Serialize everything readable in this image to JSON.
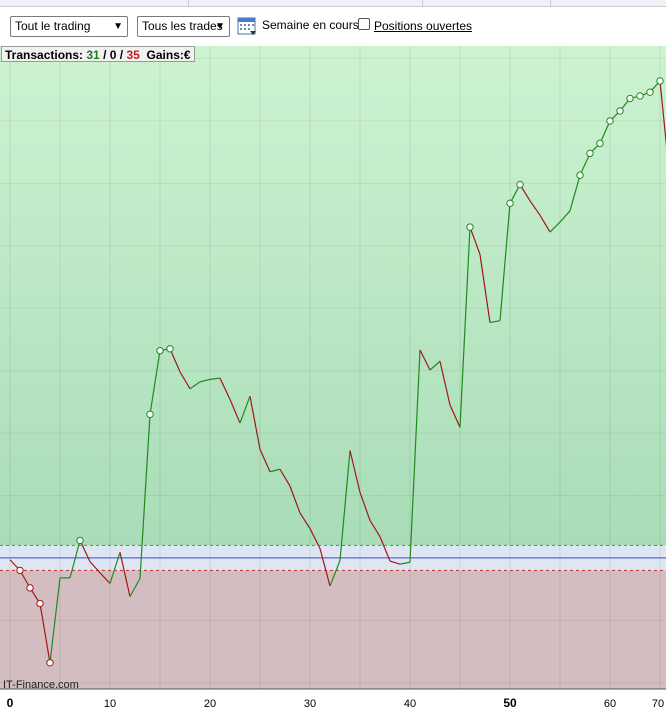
{
  "toolbar": {
    "scope_select": "Tout le trading",
    "trades_select": "Tous les trades",
    "period_label": "Semaine en cours",
    "open_positions_label": "Positions ouvertes",
    "open_positions_checked": false
  },
  "summary": {
    "label": "Transactions:",
    "winners": "31",
    "neutral": "0",
    "losers": "35",
    "separator": "/",
    "gains_label": "Gains:",
    "gains_unit": "€"
  },
  "watermark": "IT-Finance.com",
  "colors": {
    "profit_zone_top": "#cdf3d1",
    "profit_zone_bottom": "#a9dcb8",
    "loss_zone": "#d3bdc0",
    "breakeven_band": "#dfe6f3",
    "baseline": "#3b4fc2",
    "up_segment": "#1f8a1f",
    "down_segment": "#a01818",
    "marker_fill": "#ffffff"
  },
  "chart_data": {
    "type": "line",
    "xlim": [
      -1,
      70
    ],
    "ylim": [
      -21,
      82
    ],
    "x_ticks": [
      0,
      10,
      20,
      30,
      40,
      50,
      60,
      70
    ],
    "bold_ticks": [
      0,
      50
    ],
    "grid": true,
    "baseline": 0,
    "x": [
      0,
      1,
      2,
      3,
      4,
      5,
      6,
      7,
      8,
      9,
      10,
      11,
      12,
      13,
      14,
      15,
      16,
      17,
      18,
      19,
      20,
      21,
      22,
      23,
      24,
      25,
      26,
      27,
      28,
      29,
      30,
      31,
      32,
      33,
      34,
      35,
      36,
      37,
      38,
      39,
      40,
      41,
      42,
      43,
      44,
      45,
      46,
      47,
      48,
      49,
      50,
      51,
      52,
      53,
      54,
      55,
      56,
      57,
      58,
      59,
      60,
      61,
      62,
      63,
      64,
      65,
      66
    ],
    "y": [
      -0.3,
      -2.0,
      -4.8,
      -7.3,
      -16.8,
      -3.2,
      -3.2,
      2.8,
      -0.6,
      -2.4,
      -4.1,
      0.9,
      -6.2,
      -3.3,
      23.0,
      33.2,
      33.5,
      29.8,
      27.1,
      28.2,
      28.6,
      28.8,
      25.4,
      21.6,
      25.9,
      17.4,
      13.8,
      14.2,
      11.5,
      7.2,
      4.7,
      1.5,
      -4.5,
      -0.4,
      17.2,
      10.5,
      6.0,
      3.4,
      -0.5,
      -1.0,
      -0.7,
      33.3,
      30.1,
      31.5,
      24.5,
      20.9,
      53.0,
      48.6,
      37.7,
      38.0,
      56.8,
      59.8,
      57.2,
      54.9,
      52.2,
      53.8,
      55.6,
      61.3,
      64.8,
      66.4,
      70.0,
      71.6,
      73.6,
      74.0,
      74.6,
      76.4,
      60.4
    ],
    "markers": [
      1,
      2,
      3,
      4,
      7,
      14,
      15,
      16,
      46,
      50,
      51,
      57,
      58,
      59,
      60,
      61,
      62,
      63,
      64,
      65
    ]
  }
}
